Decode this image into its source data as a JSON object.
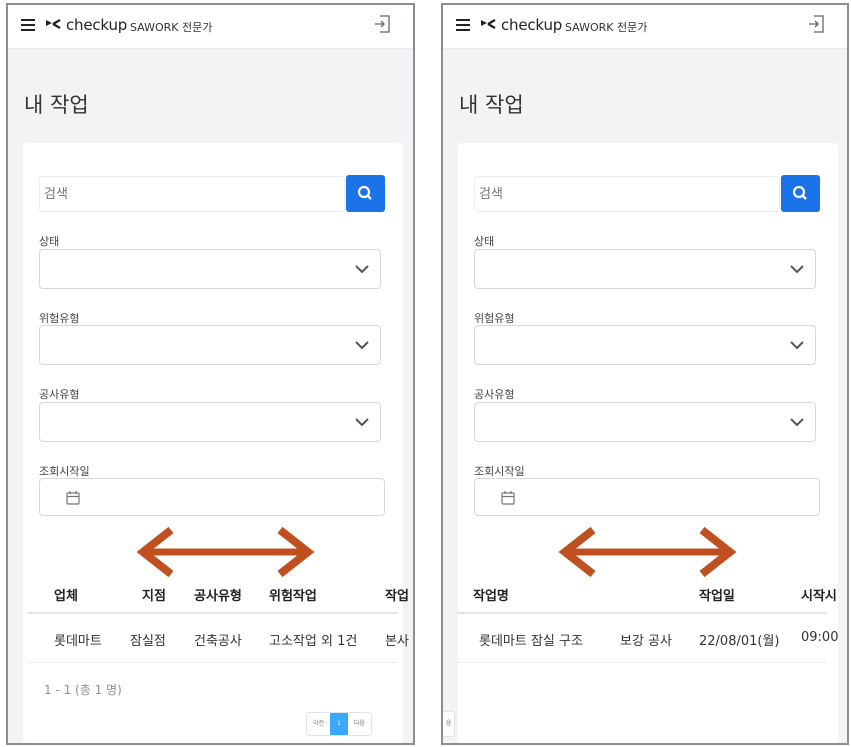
{
  "app": {
    "brand": "checkup",
    "subtitle": "SAWORK 전문가"
  },
  "page": {
    "title": "내 작업"
  },
  "filters": {
    "search_placeholder": "검색",
    "status_label": "상태",
    "risk_type_label": "위험유형",
    "construction_type_label": "공사유형",
    "start_date_label": "조회시작일"
  },
  "left_table": {
    "headers": [
      "업체",
      "지점",
      "공사유형",
      "위험작업",
      "작업"
    ],
    "row": [
      "롯데마트",
      "잠실점",
      "건축공사",
      "고소작업 외 1건",
      "본사"
    ],
    "summary": "1 - 1 (총 1 명)",
    "pager": {
      "prev": "이전",
      "page": "1",
      "next": "다음"
    }
  },
  "right_table": {
    "headers": [
      "작업명",
      "작업일",
      "시작시"
    ],
    "row": [
      "롯데마트 잠실 구조",
      "보강 공사",
      "22/08/01(월)",
      "09:00"
    ],
    "pager_tail": "음"
  },
  "colors": {
    "accent": "#1a73e8",
    "arrow": "#c0501f",
    "page_active": "#3aa8ff"
  },
  "icons": [
    "hamburger-menu-icon",
    "checkup-logo-icon",
    "logout-icon",
    "search-icon",
    "chevron-down-icon",
    "calendar-icon",
    "double-arrow-icon"
  ]
}
